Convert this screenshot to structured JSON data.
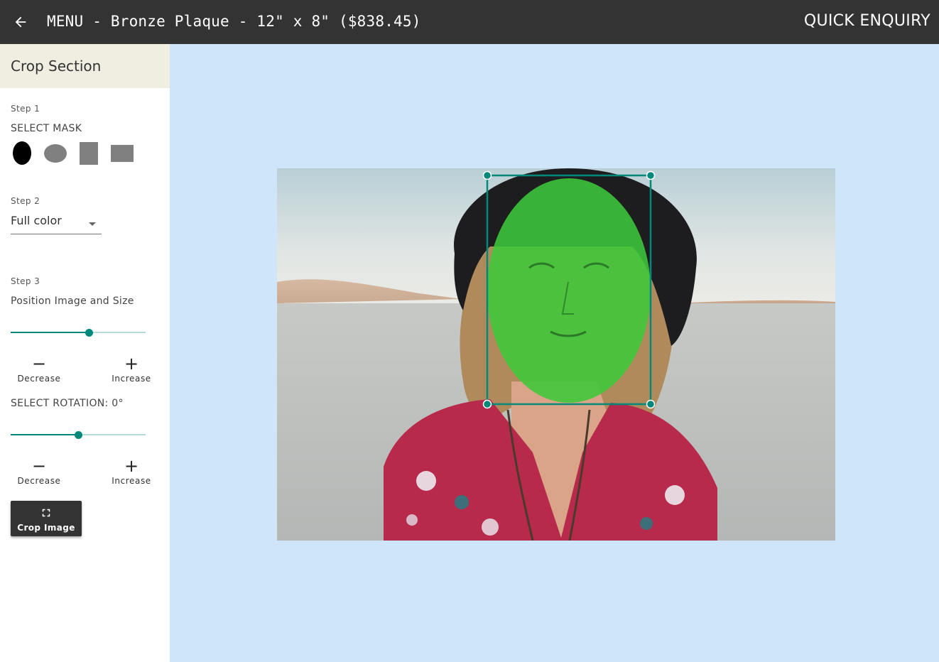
{
  "header": {
    "title": "MENU - Bronze Plaque - 12\" x 8\" ($838.45)",
    "quick_enquiry_label": "QUICK ENQUIRY"
  },
  "sidebar": {
    "title": "Crop Section",
    "step1": {
      "step_label": "Step 1",
      "title": "SELECT MASK",
      "masks": [
        "oval-vertical",
        "oval-horizontal",
        "rectangle-vertical",
        "rectangle-horizontal"
      ],
      "selected_mask": "oval-vertical"
    },
    "step2": {
      "step_label": "Step 2",
      "color_mode": "Full color"
    },
    "step3": {
      "step_label": "Step 3",
      "title": "Position Image and Size",
      "size_slider_value": 0.58,
      "decrease_label": "Decrease",
      "increase_label": "Increase",
      "rotation_label": "SELECT ROTATION: 0°",
      "rotation_slider_value": 0.5
    },
    "crop_button_label": "Crop Image"
  },
  "colors": {
    "topbar": "#333333",
    "sidebar_header": "#f0ede1",
    "canvas_background": "#cfe5fa",
    "accent_teal": "#00897b",
    "mask_overlay_green": "#3ec83a"
  },
  "icons": {
    "back": "arrow-left-icon",
    "minus": "minus-icon",
    "plus": "plus-icon",
    "crop": "fullscreen-icon"
  }
}
